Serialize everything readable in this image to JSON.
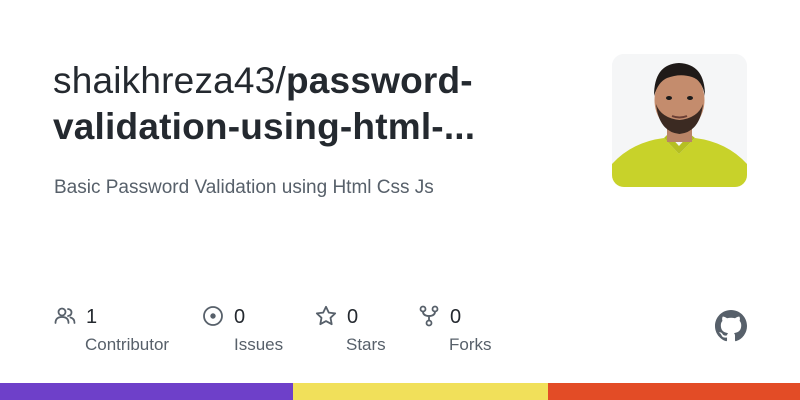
{
  "repo": {
    "owner": "shaikhreza43/",
    "name_line1": "password-",
    "name_line2": "validation-using-html-...",
    "description": "Basic Password Validation using Html Css Js"
  },
  "stats": [
    {
      "icon": "people-icon",
      "value": "1",
      "label": "Contributor"
    },
    {
      "icon": "issue-icon",
      "value": "0",
      "label": "Issues"
    },
    {
      "icon": "star-icon",
      "value": "0",
      "label": "Stars"
    },
    {
      "icon": "fork-icon",
      "value": "0",
      "label": "Forks"
    }
  ],
  "colors": {
    "bar_purple": "#6e40c9",
    "bar_yellow": "#f1e05a",
    "bar_orange": "#e34c26",
    "icon_gray": "#57606a"
  }
}
